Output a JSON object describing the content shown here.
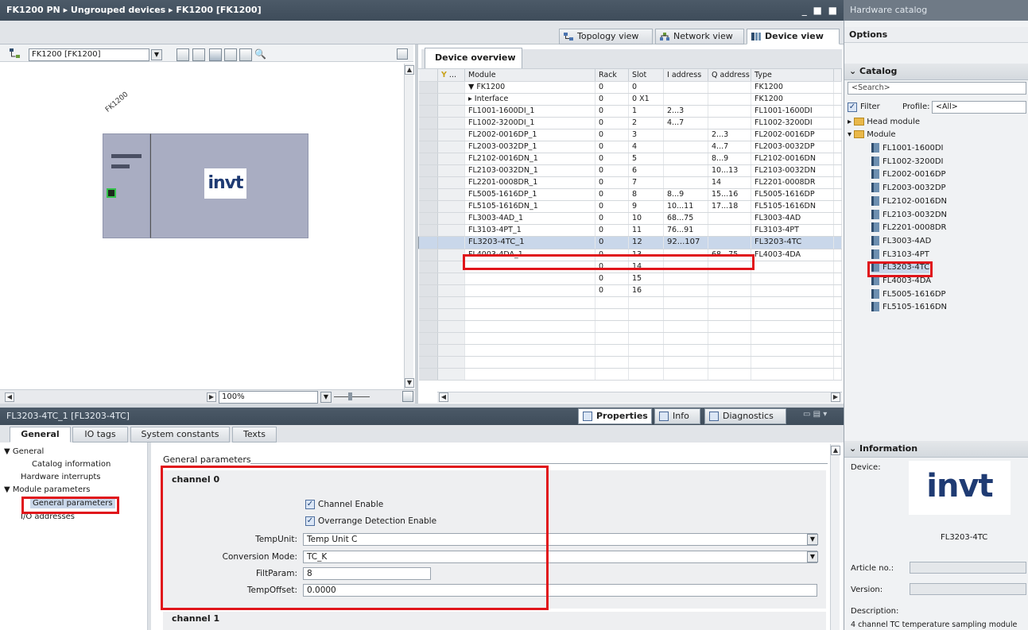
{
  "titlebar": {
    "path": "FK1200 PN ▸ Ungrouped devices ▸ FK1200 [FK1200]",
    "controls": "_ ■ ■ ✕"
  },
  "view_tabs": {
    "topology": "Topology view",
    "network": "Network view",
    "device": "Device view"
  },
  "toolbar": {
    "device_select": "FK1200 [FK1200]"
  },
  "canvas": {
    "device_label": "FK1200",
    "logo_text": "invt",
    "zoom": "100%"
  },
  "overview": {
    "tab": "Device overview",
    "columns": [
      "...",
      "Module",
      "Rack",
      "Slot",
      "I address",
      "Q address",
      "Type"
    ],
    "rows": [
      {
        "module": "▼  FK1200",
        "rack": "0",
        "slot": "0",
        "i": "",
        "q": "",
        "type": "FK1200"
      },
      {
        "module": "    ▸  Interface",
        "rack": "0",
        "slot": "0 X1",
        "i": "",
        "q": "",
        "type": "FK1200"
      },
      {
        "module": "FL1001-1600DI_1",
        "rack": "0",
        "slot": "1",
        "i": "2...3",
        "q": "",
        "type": "FL1001-1600DI"
      },
      {
        "module": "FL1002-3200DI_1",
        "rack": "0",
        "slot": "2",
        "i": "4...7",
        "q": "",
        "type": "FL1002-3200DI"
      },
      {
        "module": "FL2002-0016DP_1",
        "rack": "0",
        "slot": "3",
        "i": "",
        "q": "2...3",
        "type": "FL2002-0016DP"
      },
      {
        "module": "FL2003-0032DP_1",
        "rack": "0",
        "slot": "4",
        "i": "",
        "q": "4...7",
        "type": "FL2003-0032DP"
      },
      {
        "module": "FL2102-0016DN_1",
        "rack": "0",
        "slot": "5",
        "i": "",
        "q": "8...9",
        "type": "FL2102-0016DN"
      },
      {
        "module": "FL2103-0032DN_1",
        "rack": "0",
        "slot": "6",
        "i": "",
        "q": "10...13",
        "type": "FL2103-0032DN"
      },
      {
        "module": "FL2201-0008DR_1",
        "rack": "0",
        "slot": "7",
        "i": "",
        "q": "14",
        "type": "FL2201-0008DR"
      },
      {
        "module": "FL5005-1616DP_1",
        "rack": "0",
        "slot": "8",
        "i": "8...9",
        "q": "15...16",
        "type": "FL5005-1616DP"
      },
      {
        "module": "FL5105-1616DN_1",
        "rack": "0",
        "slot": "9",
        "i": "10...11",
        "q": "17...18",
        "type": "FL5105-1616DN"
      },
      {
        "module": "FL3003-4AD_1",
        "rack": "0",
        "slot": "10",
        "i": "68...75",
        "q": "",
        "type": "FL3003-4AD"
      },
      {
        "module": "FL3103-4PT_1",
        "rack": "0",
        "slot": "11",
        "i": "76...91",
        "q": "",
        "type": "FL3103-4PT"
      },
      {
        "module": "FL3203-4TC_1",
        "rack": "0",
        "slot": "12",
        "i": "92...107",
        "q": "",
        "type": "FL3203-4TC"
      },
      {
        "module": "FL4003-4DA_1",
        "rack": "0",
        "slot": "13",
        "i": "",
        "q": "68...75",
        "type": "FL4003-4DA"
      },
      {
        "module": "",
        "rack": "0",
        "slot": "14",
        "i": "",
        "q": "",
        "type": ""
      },
      {
        "module": "",
        "rack": "0",
        "slot": "15",
        "i": "",
        "q": "",
        "type": ""
      },
      {
        "module": "",
        "rack": "0",
        "slot": "16",
        "i": "",
        "q": "",
        "type": ""
      }
    ]
  },
  "props": {
    "title": "FL3203-4TC_1 [FL3203-4TC]",
    "tabs": {
      "properties": "Properties",
      "info": "Info",
      "diagnostics": "Diagnostics"
    },
    "sub_tabs": [
      "General",
      "IO tags",
      "System constants",
      "Texts"
    ],
    "nav": {
      "general": "▼ General",
      "catalog_info": "Catalog information",
      "hw_interrupts": "Hardware interrupts",
      "module_params": "▼ Module parameters",
      "general_params": "General parameters",
      "io_addresses": "I/O addresses"
    },
    "section_title": "General parameters",
    "channel0": "channel 0",
    "channel1": "channel 1",
    "channel_enable": "Channel Enable",
    "overrange": "Overrange Detection Enable",
    "temp_unit_label": "TempUnit:",
    "temp_unit_value": "Temp Unit C",
    "conv_mode_label": "Conversion Mode:",
    "conv_mode_value": "TC_K",
    "filt_label": "FiltParam:",
    "filt_value": "8",
    "offset_label": "TempOffset:",
    "offset_value": "0.0000"
  },
  "catalog": {
    "title": "Hardware catalog",
    "options": "Options",
    "catalog_label": "Catalog",
    "search_placeholder": "<Search>",
    "filter_label": "Filter",
    "profile_label": "Profile:",
    "profile_value": "<All>",
    "head_module": "Head module",
    "module_folder": "Module",
    "items": [
      "FL1001-1600DI",
      "FL1002-3200DI",
      "FL2002-0016DP",
      "FL2003-0032DP",
      "FL2102-0016DN",
      "FL2103-0032DN",
      "FL2201-0008DR",
      "FL3003-4AD",
      "FL3103-4PT",
      "FL3203-4TC",
      "FL4003-4DA",
      "FL5005-1616DP",
      "FL5105-1616DN"
    ]
  },
  "information": {
    "title": "Information",
    "device_label": "Device:",
    "logo_text": "invt",
    "device_name": "FL3203-4TC",
    "article_label": "Article no.:",
    "version_label": "Version:",
    "description_label": "Description:",
    "description": "4 channel TC temperature sampling module"
  }
}
